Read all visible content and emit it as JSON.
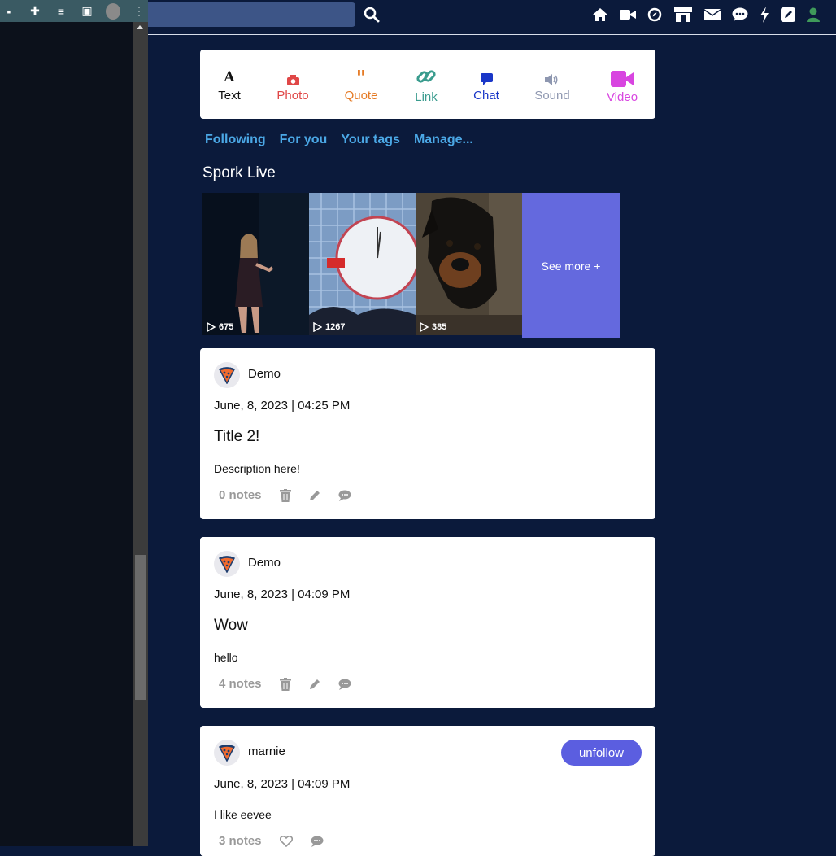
{
  "composer": {
    "items": [
      {
        "label": "Text",
        "color": "#111111"
      },
      {
        "label": "Photo",
        "color": "#e04747"
      },
      {
        "label": "Quote",
        "color": "#e57a24"
      },
      {
        "label": "Link",
        "color": "#3a9c8e"
      },
      {
        "label": "Chat",
        "color": "#1a37c8"
      },
      {
        "label": "Sound",
        "color": "#8e97b0"
      },
      {
        "label": "Video",
        "color": "#d845e0"
      }
    ]
  },
  "tabs": [
    "Following",
    "For you",
    "Your tags",
    "Manage..."
  ],
  "live": {
    "title": "Spork Live",
    "tiles": [
      {
        "count": "675"
      },
      {
        "count": "1267"
      },
      {
        "count": "385"
      }
    ],
    "see_more": "See more +"
  },
  "posts": [
    {
      "author": "Demo",
      "date": "June, 8, 2023 | 04:25 PM",
      "title": "Title 2!",
      "description": "Description here!",
      "notes": "0 notes"
    },
    {
      "author": "Demo",
      "date": "June, 8, 2023 | 04:09 PM",
      "title": "Wow",
      "description": "hello",
      "notes": "4 notes"
    },
    {
      "author": "marnie",
      "date": "June, 8, 2023 | 04:09 PM",
      "description": "I like eevee",
      "notes": "3 notes",
      "follow_button": "unfollow"
    }
  ],
  "colors": {
    "background": "#0b1a3b",
    "tab_link": "#4ba8e6",
    "see_more_bg": "#6469de",
    "unfollow_bg": "#5b5ee0"
  }
}
